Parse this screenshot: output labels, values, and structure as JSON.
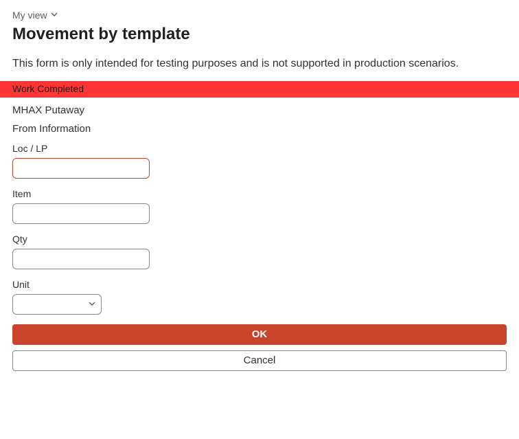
{
  "view_selector": {
    "label": "My view"
  },
  "page_title": "Movement by template",
  "disclaimer": "This form is only intended for testing purposes and is not supported in production scenarios.",
  "banner": {
    "text": "Work Completed"
  },
  "subheader": "MHAX Putaway",
  "section_label": "From Information",
  "fields": {
    "loc_lp": {
      "label": "Loc / LP",
      "value": ""
    },
    "item": {
      "label": "Item",
      "value": ""
    },
    "qty": {
      "label": "Qty",
      "value": ""
    },
    "unit": {
      "label": "Unit",
      "value": ""
    }
  },
  "buttons": {
    "ok": "OK",
    "cancel": "Cancel"
  },
  "colors": {
    "banner_bg": "#fd3535",
    "primary": "#c8442a"
  }
}
